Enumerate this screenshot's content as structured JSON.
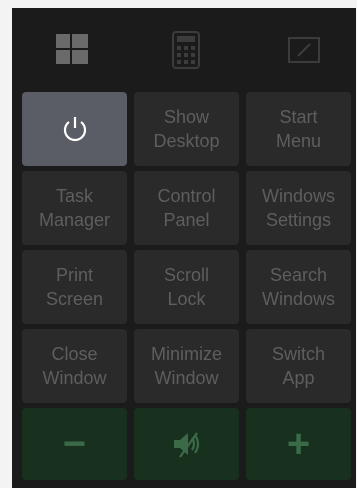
{
  "tabs": [
    {
      "icon": "windows-logo-icon",
      "active": true
    },
    {
      "icon": "calculator-icon",
      "active": false
    },
    {
      "icon": "tablet-edit-icon",
      "active": false
    }
  ],
  "buttons": {
    "power": {
      "icon": "power-icon"
    },
    "show_desktop": "Show\nDesktop",
    "start_menu": "Start\nMenu",
    "task_manager": "Task\nManager",
    "control_panel": "Control\nPanel",
    "windows_settings": "Windows\nSettings",
    "print_screen": "Print\nScreen",
    "scroll_lock": "Scroll\nLock",
    "search_windows": "Search\nWindows",
    "close_window": "Close\nWindow",
    "minimize_window": "Minimize\nWindow",
    "switch_app": "Switch\nApp",
    "volume_down": "−",
    "mute": {
      "icon": "speaker-mute-icon"
    },
    "volume_up": "+"
  },
  "colors": {
    "panel": "#1b1b1b",
    "button": "#2a2a2b",
    "active_button": "#5b5d66",
    "volume_button": "#18311f",
    "volume_glyph": "#3b6a48",
    "label_text": "#5e5e60"
  }
}
